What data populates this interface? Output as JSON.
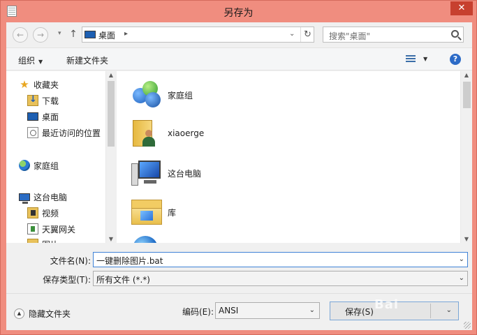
{
  "window": {
    "title": "另存为",
    "close_glyph": "✕"
  },
  "address_bar": {
    "back_glyph": "←",
    "forward_glyph": "→",
    "dropdown_glyph": "▾",
    "up_glyph": "↑",
    "path_label": "桌面",
    "separator_glyph": "▸",
    "history_glyph": "⌄",
    "refresh_glyph": "↻"
  },
  "search": {
    "placeholder": "搜索\"桌面\""
  },
  "toolbar": {
    "organize_label": "组织",
    "organize_caret": "▼",
    "new_folder_label": "新建文件夹",
    "view_caret": "▼",
    "help_glyph": "?"
  },
  "sidebar": {
    "items": [
      {
        "label": "收藏夹",
        "icon": "star-icon"
      },
      {
        "label": "下载",
        "icon": "downloads-folder-icon"
      },
      {
        "label": "桌面",
        "icon": "desktop-icon"
      },
      {
        "label": "最近访问的位置",
        "icon": "recent-places-icon"
      },
      {
        "label": "家庭组",
        "icon": "homegroup-icon"
      },
      {
        "label": "这台电脑",
        "icon": "computer-icon"
      },
      {
        "label": "视频",
        "icon": "videos-folder-icon"
      },
      {
        "label": "天翼网关",
        "icon": "network-device-icon"
      },
      {
        "label": "图片",
        "icon": "pictures-folder-icon"
      }
    ],
    "scroll_up_glyph": "▲",
    "scroll_down_glyph": "▼"
  },
  "files": {
    "items": [
      {
        "label": "家庭组",
        "icon": "homegroup-large-icon"
      },
      {
        "label": "xiaoerge",
        "icon": "user-folder-icon"
      },
      {
        "label": "这台电脑",
        "icon": "computer-large-icon"
      },
      {
        "label": "库",
        "icon": "libraries-icon"
      },
      {
        "label": "",
        "icon": "network-large-icon"
      }
    ],
    "scroll_up_glyph": "▲",
    "scroll_down_glyph": "▼"
  },
  "form": {
    "filename_label": "文件名(N):",
    "filename_value": "一键删除图片.bat",
    "filetype_label": "保存类型(T):",
    "filetype_value": "所有文件 (*.*)",
    "dropdown_glyph": "⌄"
  },
  "footer": {
    "hide_folders_label": "隐藏文件夹",
    "hide_folders_glyph": "▲",
    "encoding_label": "编码(E):",
    "encoding_value": "ANSI",
    "save_label": "保存(S)",
    "watermark": "Bai",
    "dropdown_glyph": "⌄"
  }
}
